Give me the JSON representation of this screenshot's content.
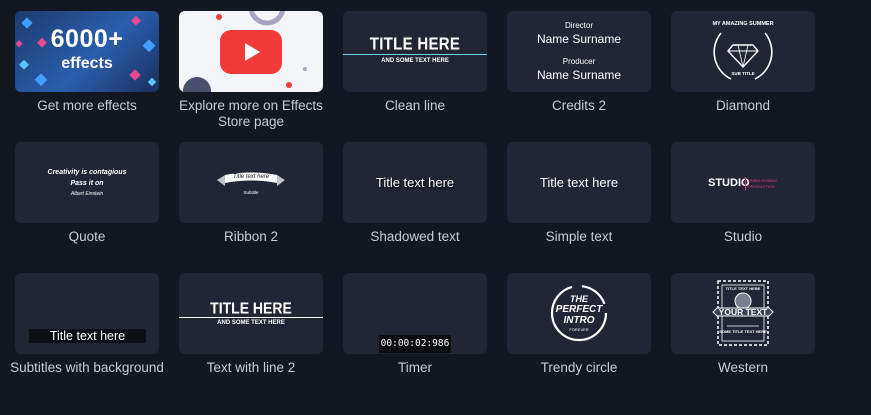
{
  "tiles": [
    {
      "label": "Get more effects"
    },
    {
      "label": "Explore more on Effects Store page"
    },
    {
      "label": "Clean line"
    },
    {
      "label": "Credits 2"
    },
    {
      "label": "Diamond"
    },
    {
      "label": "Quote"
    },
    {
      "label": "Ribbon 2"
    },
    {
      "label": "Shadowed text"
    },
    {
      "label": "Simple text"
    },
    {
      "label": "Studio"
    },
    {
      "label": "Subtitles with background"
    },
    {
      "label": "Text with line 2"
    },
    {
      "label": "Timer"
    },
    {
      "label": "Trendy circle"
    },
    {
      "label": "Western"
    }
  ],
  "previews": {
    "get_more": {
      "big": "6000+",
      "small": "effects"
    },
    "clean_line": {
      "title": "TITLE HERE",
      "sub": "AND SOME TEXT HERE"
    },
    "credits": {
      "role1": "Director",
      "name1": "Name Surname",
      "role2": "Producer",
      "name2": "Name Surname"
    },
    "diamond": {
      "top": "MY AMAZING SUMMER",
      "bottom": "SUB TITLE"
    },
    "quote": {
      "line1": "Creativity is contagious",
      "line2": "Pass it on",
      "author": "Albert Einstein"
    },
    "ribbon": {
      "main": "Title text here",
      "sub": "Subtitle"
    },
    "shadowed": {
      "text": "Title text here"
    },
    "simple": {
      "text": "Title text here"
    },
    "studio": {
      "main": "STUDIO",
      "sub1": "UNBELIEVABLE",
      "sub2": "PRODUCTION"
    },
    "subtitles": {
      "text": "Title text here"
    },
    "text_line": {
      "title": "TITLE HERE",
      "sub": "AND SOME TEXT HERE"
    },
    "timer": {
      "time": "00:00:02:986"
    },
    "trendy": {
      "l1": "THE",
      "l2": "PERFECT",
      "l3": "INTRO",
      "l4": "FOREVER"
    },
    "western": {
      "top": "TITLE TEXT HERE",
      "main": "YOUR TEXT",
      "bottom": "SOME TITLE TEXT HERE"
    }
  },
  "colors": {
    "background": "#131722",
    "tile": "#222634",
    "accent_cyan": "#6fd3e8",
    "youtube_red": "#f23a3a",
    "studio_pink": "#d9387a"
  }
}
